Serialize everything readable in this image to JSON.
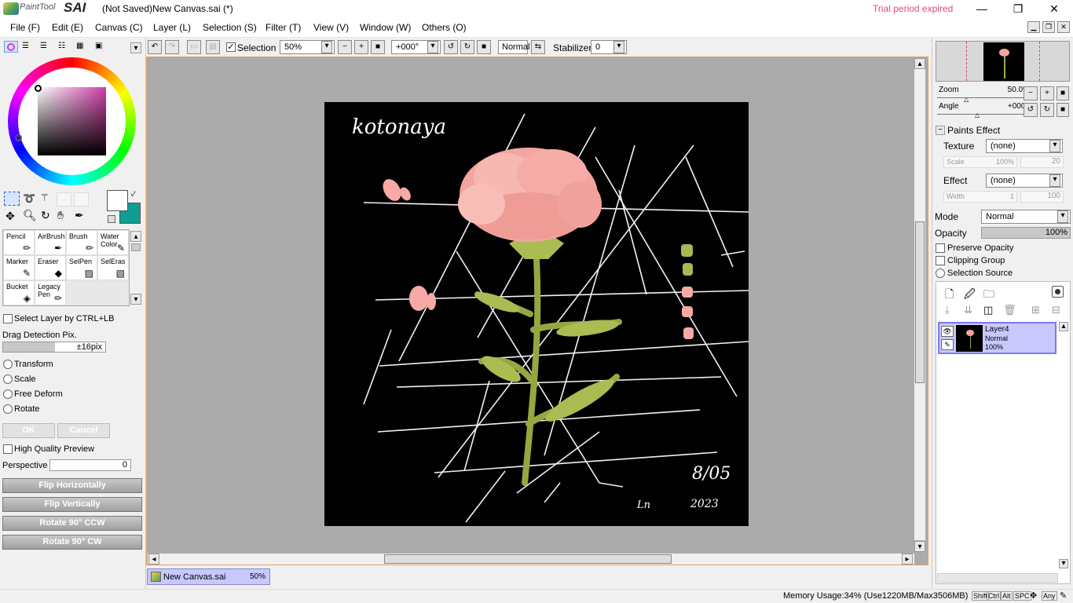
{
  "titlebar": {
    "logo_text": "PaintTool",
    "logo_brand": "SAI",
    "title": "(Not Saved)New Canvas.sai (*)",
    "trial": "Trial period expired",
    "minimize": "—",
    "restore": "❐",
    "close": "✕"
  },
  "menu": [
    "File (F)",
    "Edit (E)",
    "Canvas (C)",
    "Layer (L)",
    "Selection (S)",
    "Filter (T)",
    "View (V)",
    "Window (W)",
    "Others (O)"
  ],
  "toolbar": {
    "selection_label": "Selection",
    "zoom": "50%",
    "angle": "+000°",
    "blend": "Normal",
    "stabilizer_label": "Stabilizer",
    "stabilizer_value": "0"
  },
  "tools": [
    {
      "label": "Pencil",
      "icon": "pencil-icon"
    },
    {
      "label": "AirBrush",
      "icon": "airbrush-icon"
    },
    {
      "label": "Brush",
      "icon": "brush-icon"
    },
    {
      "label": "Water\nColor",
      "icon": "watercolor-icon"
    },
    {
      "label": "Marker",
      "icon": "marker-icon"
    },
    {
      "label": "Eraser",
      "icon": "eraser-icon"
    },
    {
      "label": "SelPen",
      "icon": "selpen-icon"
    },
    {
      "label": "SelEras",
      "icon": "seleras-icon"
    },
    {
      "label": "Bucket",
      "icon": "bucket-icon"
    },
    {
      "label": "Legacy\nPen",
      "icon": "legacy-pen-icon"
    }
  ],
  "colors": {
    "primary": "#ffffff",
    "secondary": "#0f9e91",
    "canvas_bg": "#000000",
    "accent": "#c8c8ff"
  },
  "transform_panel": {
    "select_layer": "Select Layer by CTRL+LB",
    "drag_detection_label": "Drag Detection Pix.",
    "drag_detection_value": "±16pix",
    "options": [
      "Transform",
      "Scale",
      "Free Deform",
      "Rotate"
    ],
    "ok": "OK",
    "cancel": "Cancel",
    "hq_preview": "High Quality Preview",
    "perspective_label": "Perspective",
    "perspective_value": "0",
    "flip_h": "Flip Horizontally",
    "flip_v": "Flip Vertically",
    "rot_ccw": "Rotate 90° CCW",
    "rot_cw": "Rotate 90° CW"
  },
  "canvas_art": {
    "signature_top": "kotonaya",
    "date": "8/05",
    "year": "2023",
    "initials": "Ln"
  },
  "doc_tab": {
    "name": "New Canvas.sai",
    "zoom": "50%"
  },
  "navigator": {
    "zoom_label": "Zoom",
    "zoom_value": "50.0%",
    "angle_label": "Angle",
    "angle_value": "+0008"
  },
  "paints_effect": {
    "header": "Paints Effect",
    "texture_label": "Texture",
    "texture_value": "(none)",
    "scale_label": "Scale",
    "scale_value": "100%",
    "scale_extra": "20",
    "effect_label": "Effect",
    "effect_value": "(none)",
    "width_label": "Width",
    "width_value": "1",
    "width_extra": "100"
  },
  "layer_props": {
    "mode_label": "Mode",
    "mode_value": "Normal",
    "opacity_label": "Opacity",
    "opacity_value": "100%",
    "opacity_fraction": 1.0,
    "preserve_opacity": "Preserve Opacity",
    "clipping_group": "Clipping Group",
    "selection_source": "Selection Source"
  },
  "layers": [
    {
      "name": "Layer4",
      "mode": "Normal",
      "opacity": "100%"
    }
  ],
  "status": {
    "memory": "Memory Usage:34% (Use1220MB/Max3506MB)",
    "keys": [
      "Shift",
      "Ctrl",
      "Alt",
      "SPC",
      "Any"
    ]
  }
}
